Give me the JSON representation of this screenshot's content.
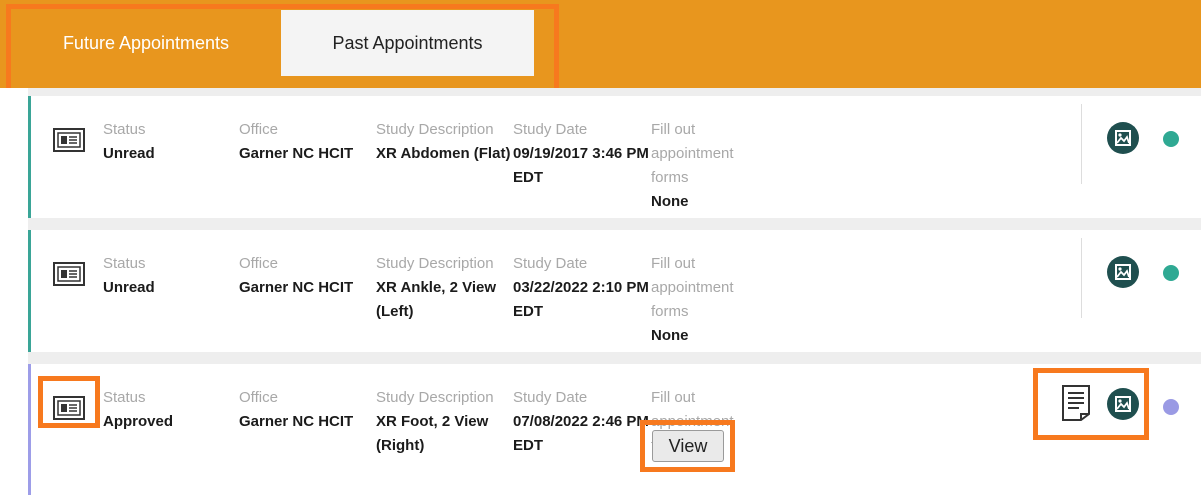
{
  "tabs": [
    {
      "label": "Future Appointments",
      "active": true
    },
    {
      "label": "Past Appointments",
      "active": false
    }
  ],
  "labels": {
    "status": "Status",
    "office": "Office",
    "study_description": "Study Description",
    "study_date": "Study Date",
    "fill_out": "Fill out appointment forms"
  },
  "appointments": [
    {
      "status": "Unread",
      "office": "Garner NC HCIT",
      "study_description": "XR Abdomen (Flat)",
      "study_date": "09/19/2017 3:46 PM EDT",
      "forms": "None",
      "indicator_color": "#2fa993"
    },
    {
      "status": "Unread",
      "office": "Garner NC HCIT",
      "study_description": "XR Ankle, 2 View (Left)",
      "study_date": "03/22/2022 2:10 PM EDT",
      "forms": "None",
      "indicator_color": "#2fa993"
    },
    {
      "status": "Approved",
      "office": "Garner NC HCIT",
      "study_description": "XR Foot, 2 View (Right)",
      "study_date": "07/08/2022 2:46 PM EDT",
      "forms_button": "View",
      "indicator_color": "#9a9ae4"
    }
  ],
  "icons": {
    "row": "newspaper-icon",
    "image": "image-icon",
    "document": "document-icon"
  },
  "colors": {
    "header": "#e8961e",
    "highlight": "#f7791e",
    "accent": "#3aa597"
  }
}
